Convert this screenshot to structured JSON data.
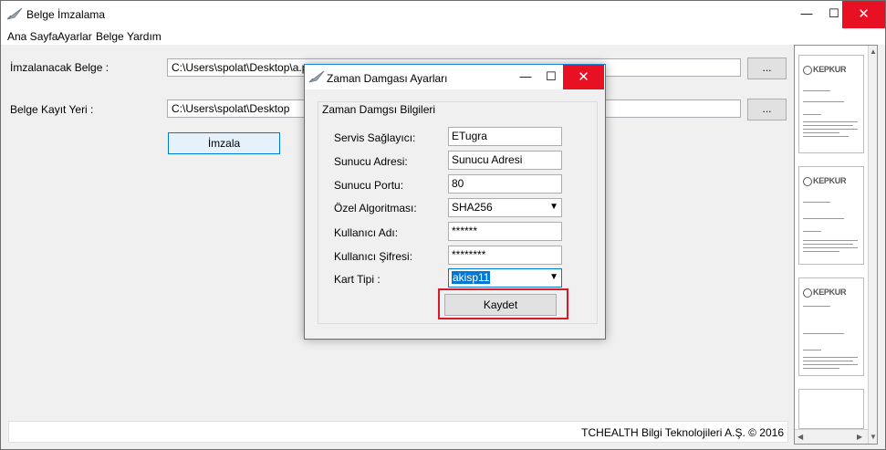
{
  "app": {
    "title": "Belge İmzalama",
    "window_controls": {
      "minimize": "—",
      "maximize": "☐",
      "close": "✕"
    }
  },
  "menu": [
    "Ana Sayfa",
    "Ayarlar",
    "Belge",
    "Yardım"
  ],
  "main": {
    "doc_label": "İmzalanacak Belge :",
    "doc_value": "C:\\Users\\spolat\\Desktop\\a.p",
    "save_location_label": "Belge Kayıt Yeri :",
    "save_location_value": "C:\\Users\\spolat\\Desktop",
    "browse_label": "...",
    "sign_button": "İmzala"
  },
  "status": {
    "text": "TCHEALTH Bilgi Teknolojileri A.Ş. ©  2016"
  },
  "preview": {
    "logo_text": "KEPKUR",
    "page_count": 3
  },
  "dialog": {
    "title": "Zaman Damgası Ayarları",
    "group_title": "Zaman Damgsı Bilgileri",
    "fields": [
      {
        "label": "Servis Sağlayıcı:",
        "value": "ETugra",
        "type": "text"
      },
      {
        "label": "Sunucu Adresi:",
        "value": "Sunucu Adresi",
        "type": "text"
      },
      {
        "label": "Sunucu Portu:",
        "value": "80",
        "type": "text"
      },
      {
        "label": "Özel Algoritması:",
        "value": "SHA256",
        "type": "select"
      },
      {
        "label": "Kullanıcı Adı:",
        "value": "******",
        "type": "text"
      },
      {
        "label": "Kullanıcı Şifresi:",
        "value": "********",
        "type": "text"
      },
      {
        "label": "Kart Tipi :",
        "value": "akisp11",
        "type": "select",
        "selected_highlight": true
      }
    ],
    "save_button": "Kaydet",
    "highlight_color": "#d81a2a",
    "accent_color": "#0078d7"
  }
}
